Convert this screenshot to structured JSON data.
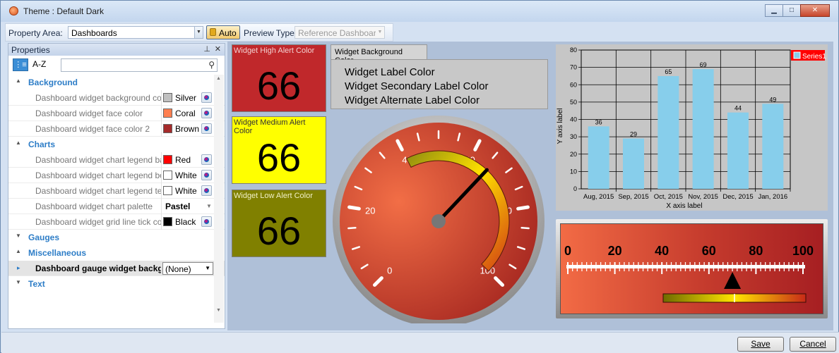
{
  "window": {
    "title": "Theme : Default Dark"
  },
  "toolbar": {
    "property_area_label": "Property Area:",
    "property_area_value": "Dashboards",
    "auto_label": "Auto",
    "preview_type_label": "Preview Type:",
    "preview_type_value": "Reference Dashboard"
  },
  "properties": {
    "title": "Properties",
    "sort_label": "A-Z",
    "search_placeholder": "",
    "categories": [
      {
        "name": "Background",
        "expanded": true
      },
      {
        "name": "Charts",
        "expanded": true
      },
      {
        "name": "Gauges",
        "expanded": false
      },
      {
        "name": "Miscellaneous",
        "expanded": true
      },
      {
        "name": "Text",
        "expanded": false
      }
    ],
    "background_rows": [
      {
        "name": "Dashboard widget background col",
        "value": "Silver",
        "color": "#C0C0C0"
      },
      {
        "name": "Dashboard widget face color",
        "value": "Coral",
        "color": "#FF7F50"
      },
      {
        "name": "Dashboard widget face color 2",
        "value": "Brown",
        "color": "#A52A2A"
      }
    ],
    "chart_rows": [
      {
        "name": "Dashboard widget chart legend ba",
        "value": "Red",
        "color": "#FF0000"
      },
      {
        "name": "Dashboard widget chart legend bo",
        "value": "White",
        "color": "#FFFFFF"
      },
      {
        "name": "Dashboard widget chart legend tex",
        "value": "White",
        "color": "#FFFFFF"
      },
      {
        "name": "Dashboard widget chart palette",
        "value": "Pastel"
      },
      {
        "name": "Dashboard widget grid line tick col",
        "value": "Black",
        "color": "#000000"
      }
    ],
    "misc_rows": [
      {
        "name": "Dashboard gauge widget backgrou",
        "value": "(None)"
      }
    ]
  },
  "alerts": {
    "high": {
      "label": "Widget High Alert Color",
      "value": "66",
      "color": "#C0282B"
    },
    "medium": {
      "label": "Widget Medium Alert Color",
      "value": "66",
      "color": "#FFFF00"
    },
    "low": {
      "label": "Widget Low Alert Color",
      "value": "66",
      "color": "#808000"
    }
  },
  "label_colors": {
    "tab": "Widget Background Color",
    "lines": [
      "Widget Label Color",
      "Widget Secondary Label Color",
      "Widget Alternate Label Color"
    ]
  },
  "radial_gauge": {
    "min": 0,
    "max": 100,
    "value": 66,
    "tick_labels": [
      "0",
      "20",
      "40",
      "60",
      "80",
      "100"
    ]
  },
  "linear_gauge": {
    "min": 0,
    "max": 100,
    "value": 70,
    "tick_labels": [
      "0",
      "20",
      "40",
      "60",
      "80",
      "100"
    ]
  },
  "chart_data": {
    "type": "bar",
    "categories": [
      "Aug, 2015",
      "Sep, 2015",
      "Oct, 2015",
      "Nov, 2015",
      "Dec, 2015",
      "Jan, 2016"
    ],
    "series": [
      {
        "name": "Series1",
        "values": [
          36,
          29,
          65,
          69,
          44,
          49
        ],
        "color": "#87CEEB"
      }
    ],
    "xlabel": "X axis label",
    "ylabel": "Y axis label",
    "ylim": [
      0,
      80
    ],
    "yticks": [
      "0",
      "10",
      "20",
      "30",
      "40",
      "50",
      "60",
      "70",
      "80"
    ],
    "grid": true,
    "legend": "top-right",
    "legend_color": "#FF0000"
  },
  "buttons": {
    "save": "Save",
    "cancel": "Cancel"
  }
}
